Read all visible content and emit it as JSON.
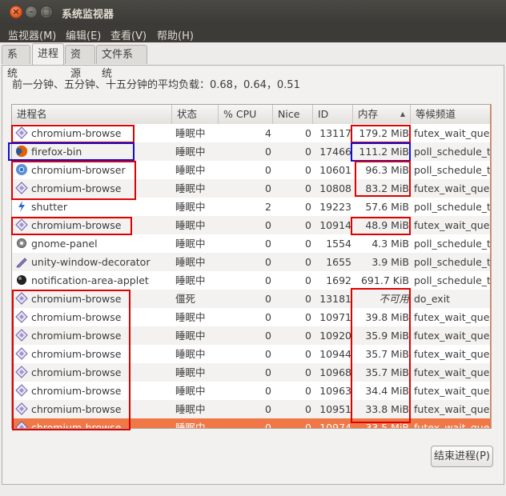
{
  "window": {
    "title": "系统监视器"
  },
  "menubar": {
    "items": [
      "监视器(M)",
      "编辑(E)",
      "查看(V)",
      "帮助(H)"
    ]
  },
  "tabs": [
    {
      "label": "系统",
      "active": false
    },
    {
      "label": "进程",
      "active": true
    },
    {
      "label": "资源",
      "active": false
    },
    {
      "label": "文件系统",
      "active": false
    }
  ],
  "load_average_text": "前一分钟、五分钟、十五分钟的平均负载：0.68，0.64，0.51",
  "table": {
    "columns": [
      "进程名",
      "状态",
      "% CPU",
      "Nice",
      "ID",
      "内存",
      "等候频道"
    ],
    "sort_column": "内存",
    "sort_direction": "descending",
    "rows": [
      {
        "icon": "chromium-puzzle-icon",
        "name": "chromium-browse",
        "state": "睡眠中",
        "cpu": "4",
        "nice": "0",
        "pid": "13117",
        "mem": "179.2 MiB",
        "wchan": "futex_wait_queue_me"
      },
      {
        "icon": "firefox-icon",
        "name": "firefox-bin",
        "state": "睡眠中",
        "cpu": "0",
        "nice": "0",
        "pid": "17466",
        "mem": "111.2 MiB",
        "wchan": "poll_schedule_timeout"
      },
      {
        "icon": "chromium-logo-icon",
        "name": "chromium-browser",
        "state": "睡眠中",
        "cpu": "0",
        "nice": "0",
        "pid": "10601",
        "mem": "96.3 MiB",
        "wchan": "poll_schedule_timeout"
      },
      {
        "icon": "chromium-puzzle-icon",
        "name": "chromium-browse",
        "state": "睡眠中",
        "cpu": "0",
        "nice": "0",
        "pid": "10808",
        "mem": "83.2 MiB",
        "wchan": "futex_wait_queue_me"
      },
      {
        "icon": "shutter-icon",
        "name": "shutter",
        "state": "睡眠中",
        "cpu": "2",
        "nice": "0",
        "pid": "19223",
        "mem": "57.6 MiB",
        "wchan": "poll_schedule_timeout"
      },
      {
        "icon": "chromium-puzzle-icon",
        "name": "chromium-browse",
        "state": "睡眠中",
        "cpu": "0",
        "nice": "0",
        "pid": "10914",
        "mem": "48.9 MiB",
        "wchan": "futex_wait_queue_me"
      },
      {
        "icon": "gear-icon",
        "name": "gnome-panel",
        "state": "睡眠中",
        "cpu": "0",
        "nice": "0",
        "pid": "1554",
        "mem": "4.3 MiB",
        "wchan": "poll_schedule_timeout"
      },
      {
        "icon": "pen-icon",
        "name": "unity-window-decorator",
        "state": "睡眠中",
        "cpu": "0",
        "nice": "0",
        "pid": "1655",
        "mem": "3.9 MiB",
        "wchan": "poll_schedule_timeout"
      },
      {
        "icon": "notification-icon",
        "name": "notification-area-applet",
        "state": "睡眠中",
        "cpu": "0",
        "nice": "0",
        "pid": "1692",
        "mem": "691.7 KiB",
        "wchan": "poll_schedule_timeout"
      },
      {
        "icon": "chromium-puzzle-icon",
        "name": "chromium-browse",
        "state": "僵死",
        "cpu": "0",
        "nice": "0",
        "pid": "13181",
        "mem": "不可用",
        "wchan": "do_exit",
        "mem_na": true
      },
      {
        "icon": "chromium-puzzle-icon",
        "name": "chromium-browse",
        "state": "睡眠中",
        "cpu": "0",
        "nice": "0",
        "pid": "10971",
        "mem": "39.8 MiB",
        "wchan": "futex_wait_queue_me"
      },
      {
        "icon": "chromium-puzzle-icon",
        "name": "chromium-browse",
        "state": "睡眠中",
        "cpu": "0",
        "nice": "0",
        "pid": "10920",
        "mem": "35.9 MiB",
        "wchan": "futex_wait_queue_me"
      },
      {
        "icon": "chromium-puzzle-icon",
        "name": "chromium-browse",
        "state": "睡眠中",
        "cpu": "0",
        "nice": "0",
        "pid": "10944",
        "mem": "35.7 MiB",
        "wchan": "futex_wait_queue_me"
      },
      {
        "icon": "chromium-puzzle-icon",
        "name": "chromium-browse",
        "state": "睡眠中",
        "cpu": "0",
        "nice": "0",
        "pid": "10968",
        "mem": "35.7 MiB",
        "wchan": "futex_wait_queue_me"
      },
      {
        "icon": "chromium-puzzle-icon",
        "name": "chromium-browse",
        "state": "睡眠中",
        "cpu": "0",
        "nice": "0",
        "pid": "10963",
        "mem": "34.4 MiB",
        "wchan": "futex_wait_queue_me"
      },
      {
        "icon": "chromium-puzzle-icon",
        "name": "chromium-browse",
        "state": "睡眠中",
        "cpu": "0",
        "nice": "0",
        "pid": "10951",
        "mem": "33.8 MiB",
        "wchan": "futex_wait_queue_me"
      },
      {
        "icon": "chromium-puzzle-icon",
        "name": "chromium-browse",
        "state": "睡眠中",
        "cpu": "0",
        "nice": "0",
        "pid": "10974",
        "mem": "33.5 MiB",
        "wchan": "futex_wait_queue_me",
        "selected": true
      }
    ]
  },
  "buttons": {
    "end_process": "结束进程(P)"
  },
  "colors": {
    "selection": "#f07746",
    "annotation_red": "#e00000",
    "annotation_blue": "#1010d0",
    "titlebar": "#3c3b37"
  }
}
